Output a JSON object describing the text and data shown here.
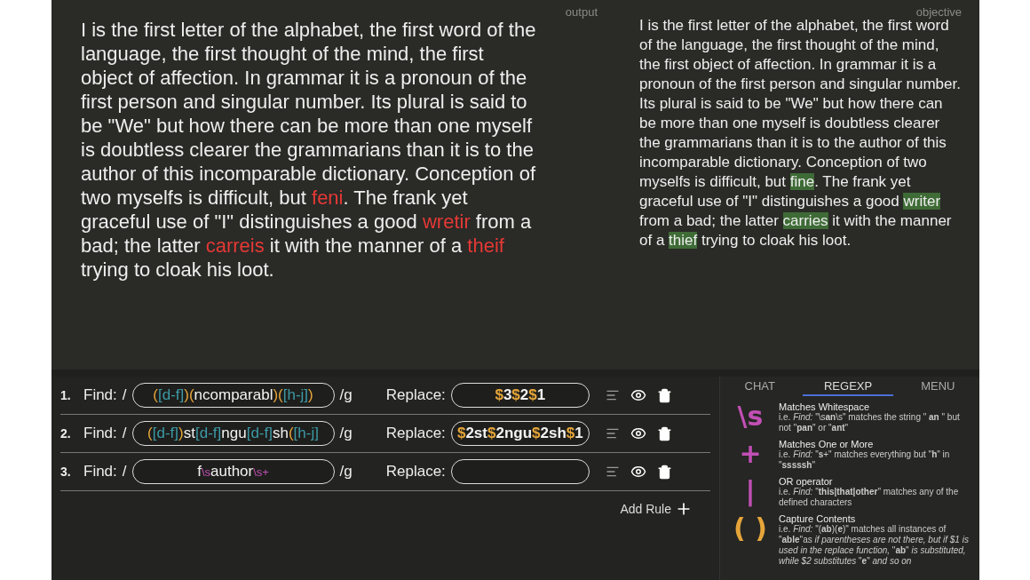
{
  "output": {
    "label": "output",
    "segments": [
      {
        "kind": "plain",
        "text": "I is the first letter of the alphabet, the first word of the language, the first thought of the mind, the first object of affection. In grammar it is a pronoun of the first person and singular number. Its plural is said to be \"We\" but how there can be more than one myself is doubtless clearer the grammarians than it is to the author of this incomparable dictionary. Conception of two myselfs is difficult, but "
      },
      {
        "kind": "error",
        "text": "feni"
      },
      {
        "kind": "plain",
        "text": ". The frank yet graceful use of \"I\" distinguishes a good "
      },
      {
        "kind": "error",
        "text": "wretir"
      },
      {
        "kind": "plain",
        "text": " from a bad; the latter "
      },
      {
        "kind": "error",
        "text": "carreis"
      },
      {
        "kind": "plain",
        "text": " it with the manner of a "
      },
      {
        "kind": "error",
        "text": "theif"
      },
      {
        "kind": "plain",
        "text": " trying to cloak his loot."
      }
    ]
  },
  "objective": {
    "label": "objective",
    "segments": [
      {
        "kind": "plain",
        "text": "I is the first letter of the alphabet, the first word of the language, the first thought of the mind, the first object of affection. In grammar it is a pronoun of the first person and singular number. Its plural is said to be \"We\" but how there can be more than one myself is doubtless clearer the grammarians than it is to the author of this incomparable dictionary. Conception of two myselfs is difficult, but "
      },
      {
        "kind": "match",
        "text": "fine"
      },
      {
        "kind": "plain",
        "text": ". The frank yet graceful use of \"I\" distinguishes a good "
      },
      {
        "kind": "match",
        "text": "writer"
      },
      {
        "kind": "plain",
        "text": " from a bad; the latter "
      },
      {
        "kind": "match",
        "text": "carries"
      },
      {
        "kind": "plain",
        "text": " it with the manner of a "
      },
      {
        "kind": "match",
        "text": "thief"
      },
      {
        "kind": "plain",
        "text": " trying to cloak his loot."
      }
    ]
  },
  "rules": [
    {
      "number": "1.",
      "find_label": "Find:",
      "open": "/",
      "close": "/g",
      "replace_label": "Replace:",
      "find": [
        {
          "kind": "group",
          "text": "("
        },
        {
          "kind": "class",
          "text": "[d-f]"
        },
        {
          "kind": "group",
          "text": ")("
        },
        {
          "kind": "literal",
          "text": "ncomparabl"
        },
        {
          "kind": "group",
          "text": ")("
        },
        {
          "kind": "class",
          "text": "[h-j]"
        },
        {
          "kind": "group",
          "text": ")"
        }
      ],
      "replace": [
        {
          "kind": "ref",
          "text": "$"
        },
        {
          "kind": "literal",
          "text": "3"
        },
        {
          "kind": "ref",
          "text": "$"
        },
        {
          "kind": "literal",
          "text": "2"
        },
        {
          "kind": "ref",
          "text": "$"
        },
        {
          "kind": "literal",
          "text": "1"
        }
      ]
    },
    {
      "number": "2.",
      "find_label": "Find:",
      "open": "/",
      "close": "/g",
      "replace_label": "Replace:",
      "find": [
        {
          "kind": "group",
          "text": "("
        },
        {
          "kind": "class",
          "text": "[d-f]"
        },
        {
          "kind": "group",
          "text": ")"
        },
        {
          "kind": "literal",
          "text": "st"
        },
        {
          "kind": "class",
          "text": "[d-f]"
        },
        {
          "kind": "literal",
          "text": "ngu"
        },
        {
          "kind": "class",
          "text": "[d-f]"
        },
        {
          "kind": "literal",
          "text": "sh"
        },
        {
          "kind": "group",
          "text": "("
        },
        {
          "kind": "class",
          "text": "[h-j]"
        }
      ],
      "replace": [
        {
          "kind": "ref",
          "text": "$"
        },
        {
          "kind": "literal",
          "text": "2st"
        },
        {
          "kind": "ref",
          "text": "$"
        },
        {
          "kind": "literal",
          "text": "2ngu"
        },
        {
          "kind": "ref",
          "text": "$"
        },
        {
          "kind": "literal",
          "text": "2sh"
        },
        {
          "kind": "ref",
          "text": "$"
        },
        {
          "kind": "literal",
          "text": "1"
        }
      ]
    },
    {
      "number": "3.",
      "find_label": "Find:",
      "open": "/",
      "close": "/g",
      "replace_label": "Replace:",
      "find": [
        {
          "kind": "literal",
          "text": "f"
        },
        {
          "kind": "special",
          "text": "\\s"
        },
        {
          "kind": "literal",
          "text": "author"
        },
        {
          "kind": "special",
          "text": "\\s+"
        }
      ]
    }
  ],
  "add_rule": "Add Rule",
  "tabs": [
    {
      "label": "CHAT",
      "selected": false
    },
    {
      "label": "REGEXP",
      "selected": true
    },
    {
      "label": "MENU",
      "selected": false
    }
  ],
  "help": [
    {
      "symbol": "\\s",
      "color": "#c24fb5",
      "title": "Matches Whitespace",
      "text": "i.e. *Find:* \"\\s**an**\\s\" matches the string \" **an** \" but not \"**pan**\" or \"**ant**\""
    },
    {
      "symbol": "+",
      "color": "#c24fb5",
      "title": "Matches One or More",
      "text": "i.e. *Find:* \"**s**+\" matches everything but \"**h**\" in \"**sssssh**\""
    },
    {
      "symbol": "|",
      "color": "#c24fb5",
      "title": "OR operator",
      "text": "i.e. *Find:* \"**this|that|other**\" matches any of the defined characters"
    },
    {
      "symbol": "( )",
      "color": "#e5a53a",
      "title": "Capture Contents",
      "text": "i.e. *Find:* \"(**ab**)(**e**)\" matches all instances of \"**able**\"as *if parentheses are not there, but if $1 is used in the replace function,* \"**ab**\" *is substituted, while $2 substitutes* \"**e**\" *and so on*"
    }
  ]
}
